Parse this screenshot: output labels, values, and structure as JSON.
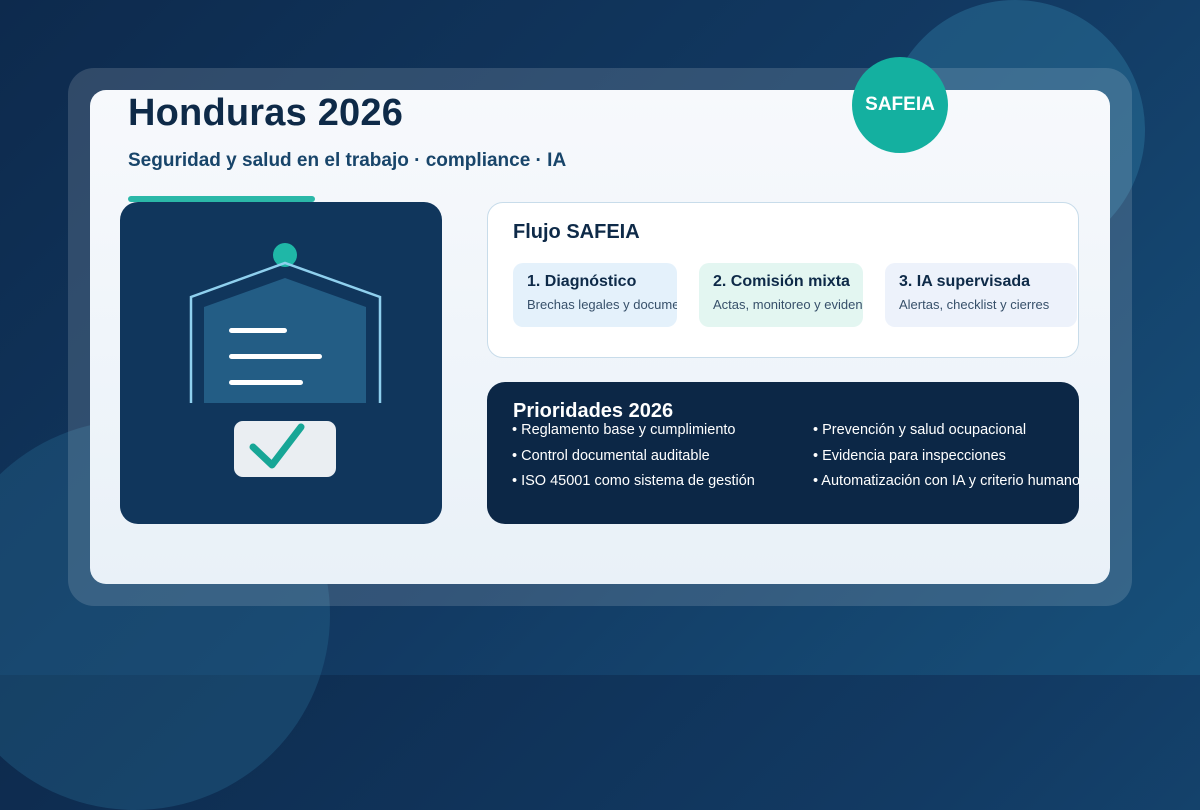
{
  "header": {
    "title": "Honduras 2026",
    "subtitle": "Seguridad y salud en el trabajo · compliance · IA",
    "badge": "SAFEIA"
  },
  "illustration": {
    "icons": [
      "document-icon",
      "check-icon"
    ]
  },
  "flow": {
    "title": "Flujo SAFEIA",
    "steps": [
      {
        "title": "1. Diagnóstico",
        "desc": "Brechas legales y documentales"
      },
      {
        "title": "2. Comisión mixta",
        "desc": "Actas, monitoreo y evidencia"
      },
      {
        "title": "3. IA supervisada",
        "desc": "Alertas, checklist y cierres"
      }
    ]
  },
  "priorities": {
    "title": "Prioridades 2026",
    "left": [
      "• Reglamento base y cumplimiento",
      "• Control documental auditable",
      "• ISO 45001 como sistema de gestión"
    ],
    "right": [
      "• Prevención y salud ocupacional",
      "• Evidencia para inspecciones",
      "• Automatización con IA y criterio humano"
    ]
  },
  "colors": {
    "accent": "#14b0a0",
    "navy": "#0c2746",
    "background": "#123a63"
  }
}
